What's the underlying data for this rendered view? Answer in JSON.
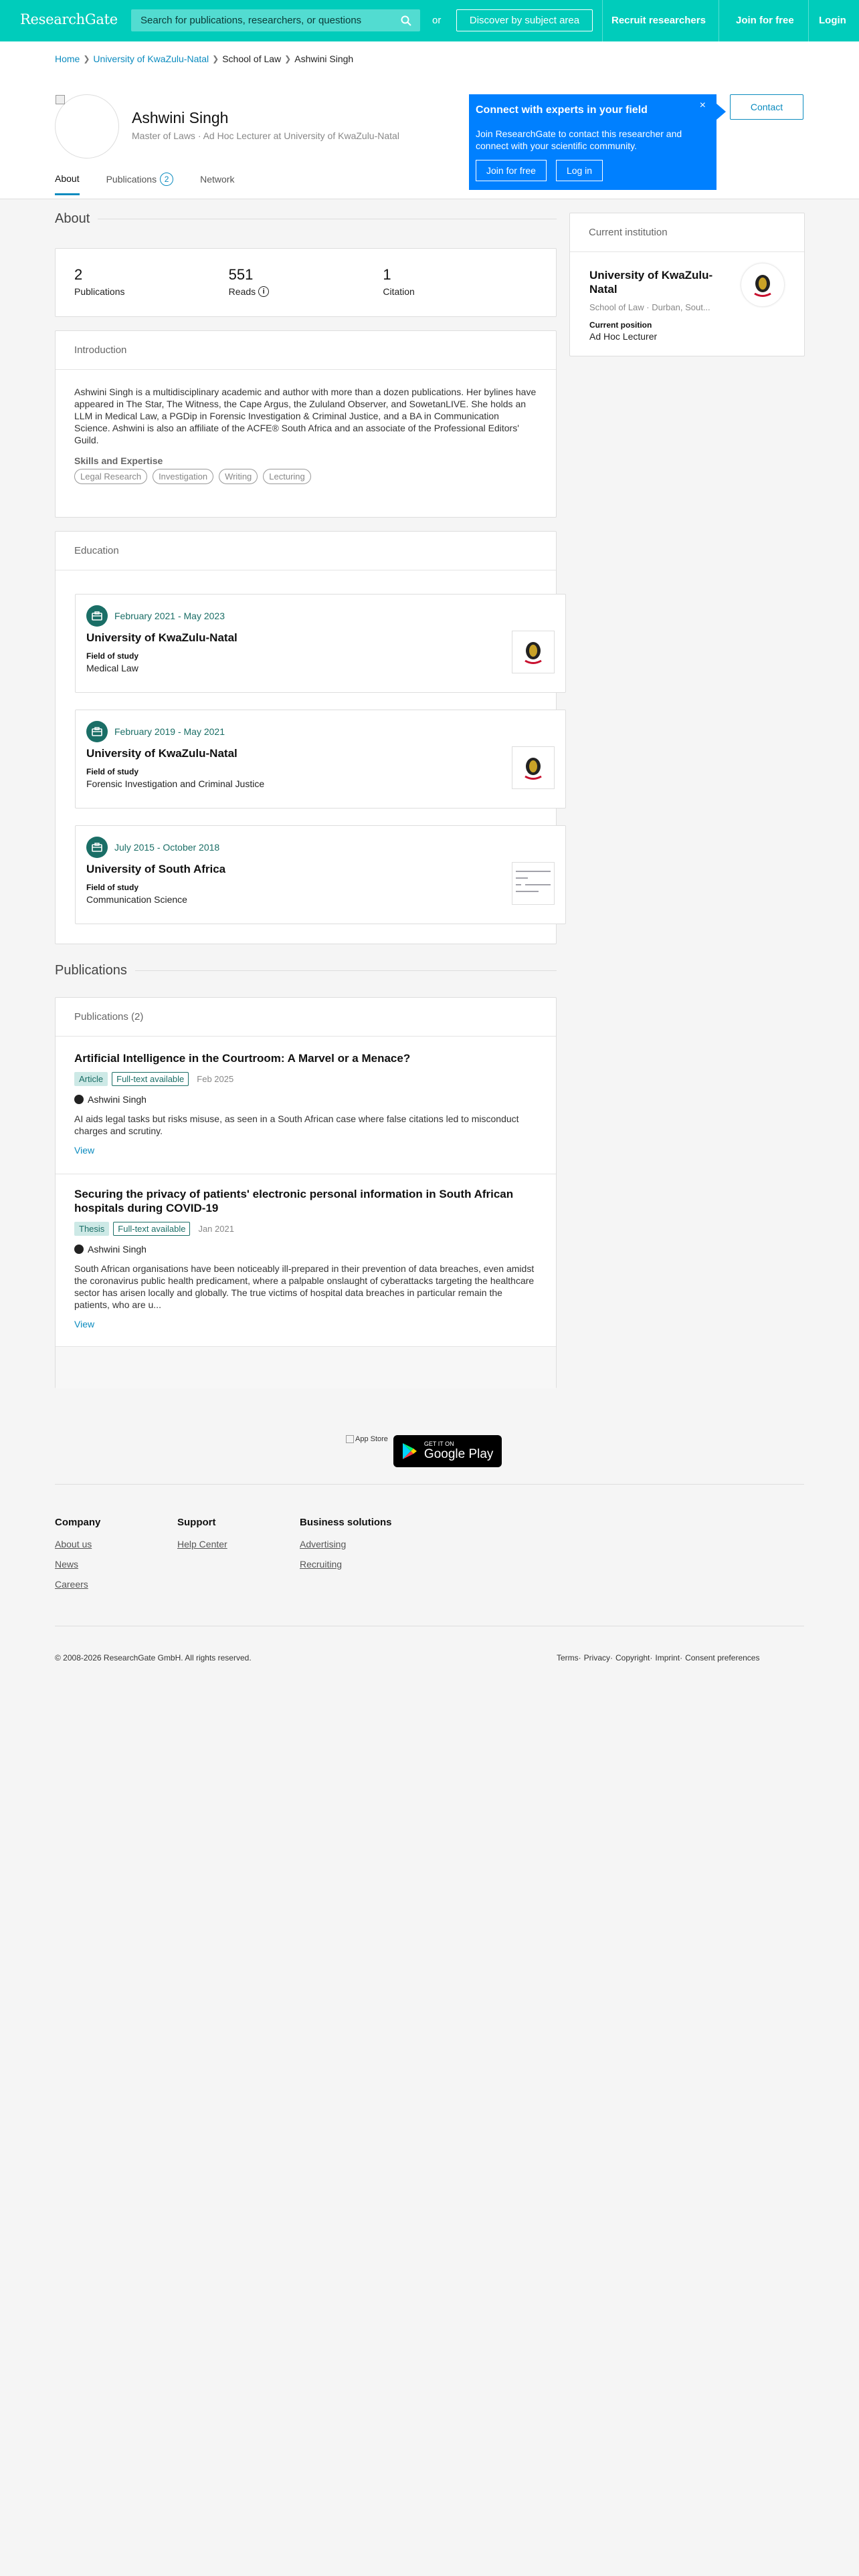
{
  "nav": {
    "logo": "ResearchGate",
    "search_placeholder": "Search for publications, researchers, or questions",
    "or": "or",
    "discover": "Discover by subject area",
    "recruit": "Recruit researchers",
    "join": "Join for free",
    "login": "Login"
  },
  "breadcrumb": [
    "Home",
    "University of KwaZulu-Natal",
    "School of Law",
    "Ashwini Singh"
  ],
  "profile": {
    "name": "Ashwini Singh",
    "subtitle": "Master of Laws · Ad Hoc Lecturer at University of KwaZulu-Natal"
  },
  "tabs": {
    "about": "About",
    "publications": "Publications",
    "publications_count": "2",
    "network": "Network"
  },
  "connect": {
    "title": "Connect with experts in your field",
    "text": "Join ResearchGate to contact this researcher and connect with your scientific community.",
    "join": "Join for free",
    "login": "Log in",
    "close": "×"
  },
  "contact": "Contact",
  "about": {
    "heading": "About",
    "stats": [
      {
        "value": "2",
        "label": "Publications"
      },
      {
        "value": "551",
        "label": "Reads"
      },
      {
        "value": "1",
        "label": "Citation"
      }
    ]
  },
  "intro": {
    "title": "Introduction",
    "text": "Ashwini Singh is a multidisciplinary academic and author with more than a dozen publications. Her bylines have appeared in The Star, The Witness, the Cape Argus, the Zululand Observer, and SowetanLIVE. She holds an LLM in Medical Law, a PGDip in Forensic Investigation & Criminal Justice, and a BA in Communication Science. Ashwini is also an affiliate of the ACFE® South Africa and an associate of the Professional Editors' Guild.",
    "skills_title": "Skills and Expertise",
    "skills": [
      "Legal Research",
      "Investigation",
      "Writing",
      "Lecturing"
    ]
  },
  "education": {
    "title": "Education",
    "items": [
      {
        "date": "February 2021 - May 2023",
        "school": "University of KwaZulu-Natal",
        "fos_label": "Field of study",
        "fos": "Medical Law"
      },
      {
        "date": "February 2019 - May 2021",
        "school": "University of KwaZulu-Natal",
        "fos_label": "Field of study",
        "fos": "Forensic Investigation and Criminal Justice"
      },
      {
        "date": "July 2015 - October 2018",
        "school": "University of South Africa",
        "fos_label": "Field of study",
        "fos": "Communication Science"
      }
    ]
  },
  "publications": {
    "heading": "Publications",
    "card_title": "Publications (2)",
    "items": [
      {
        "title": "Artificial Intelligence in the Courtroom: A Marvel or a Menace?",
        "type": "Article",
        "fulltext": "Full-text available",
        "date": "Feb 2025",
        "author": "Ashwini Singh",
        "abstract": "AI aids legal tasks but risks misuse, as seen in a South African case where false citations led to misconduct charges and scrutiny.",
        "view": "View"
      },
      {
        "title": "Securing the privacy of patients' electronic personal information in South African hospitals during COVID-19",
        "type": "Thesis",
        "fulltext": "Full-text available",
        "date": "Jan 2021",
        "author": "Ashwini Singh",
        "abstract": "South African organisations have been noticeably ill-prepared in their prevention of data breaches, even amidst the coronavirus public health predicament, where a palpable onslaught of cyberattacks targeting the healthcare sector has arisen locally and globally. The true victims of hospital data breaches in particular remain the patients, who are u...",
        "view": "View"
      }
    ]
  },
  "institution": {
    "title": "Current institution",
    "name": "University of KwaZulu-Natal",
    "sub": "School of Law · Durban, Sout...",
    "pos_label": "Current position",
    "position": "Ad Hoc Lecturer"
  },
  "apps": {
    "appstore": "App Store",
    "gp_small": "GET IT ON",
    "gp_big": "Google Play"
  },
  "footer": {
    "company": {
      "title": "Company",
      "links": [
        "About us",
        "News",
        "Careers"
      ]
    },
    "support": {
      "title": "Support",
      "links": [
        "Help Center"
      ]
    },
    "business": {
      "title": "Business solutions",
      "links": [
        "Advertising",
        "Recruiting"
      ]
    },
    "copyright": "© 2008-2026 ResearchGate GmbH. All rights reserved.",
    "legal": [
      "Terms",
      "Privacy",
      "Copyright",
      "Imprint",
      "Consent preferences"
    ]
  },
  "colors": {
    "brand": "#00ccbb",
    "link": "#0b8bbf",
    "connect": "#0080ff",
    "teal_dark": "#1a6e66"
  }
}
